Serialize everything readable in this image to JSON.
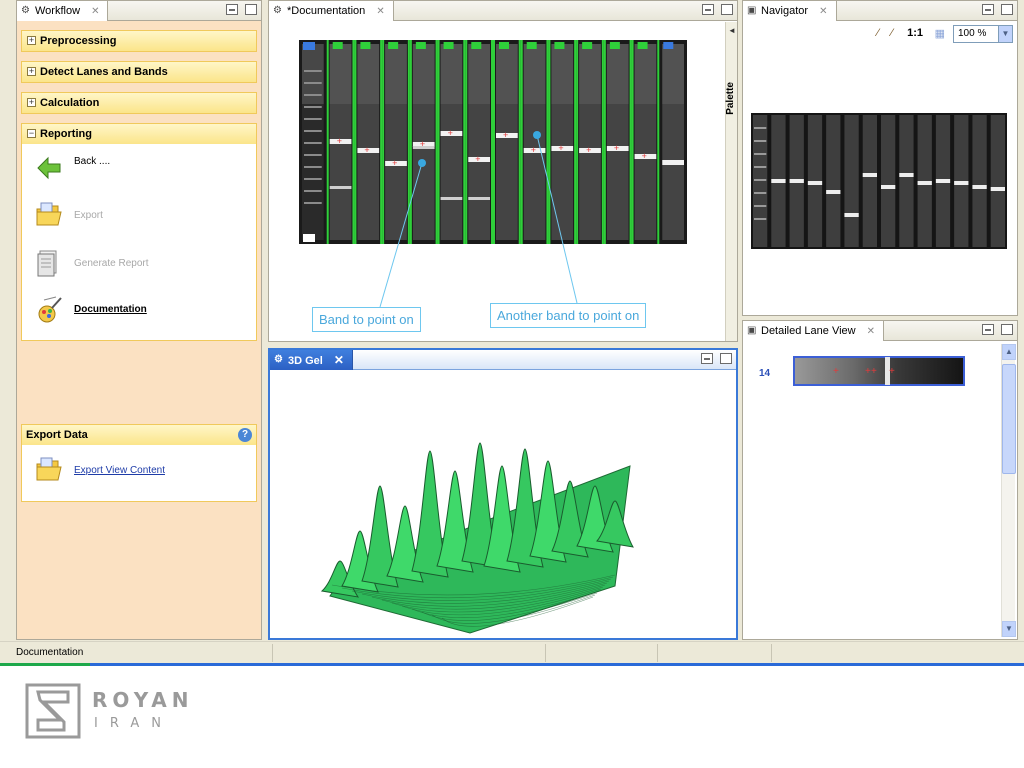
{
  "workflow": {
    "tab_title": "Workflow",
    "sections": [
      {
        "title": "Preprocessing"
      },
      {
        "title": "Detect Lanes and Bands"
      },
      {
        "title": "Calculation"
      },
      {
        "title": "Reporting"
      }
    ],
    "reporting_items": [
      {
        "label": "Back ....",
        "icon": "back-arrow-icon",
        "enabled": true
      },
      {
        "label": "Export",
        "icon": "export-folder-icon",
        "enabled": false
      },
      {
        "label": "Generate Report",
        "icon": "report-icon",
        "enabled": false
      },
      {
        "label": "Documentation",
        "icon": "documentation-icon",
        "enabled": true,
        "active": true
      }
    ],
    "export_data": {
      "title": "Export Data",
      "item_label": "Export View Content"
    }
  },
  "documentation": {
    "tab_title": "*Documentation",
    "palette_label": "Palette",
    "callouts": [
      "Band to point on",
      "Another band to point on"
    ]
  },
  "navigator": {
    "tab_title": "Navigator",
    "zoom_ratio_label": "1:1",
    "zoom_value": "100 %"
  },
  "lane_view": {
    "tab_title": "Detailed Lane View",
    "lane_number": "14"
  },
  "gel3d": {
    "tab_title": "3D Gel"
  },
  "status_bar": {
    "text": "Documentation"
  },
  "logo": {
    "word1": "ROYAN",
    "word2": "IRAN"
  },
  "colors": {
    "workflow_bg": "#fbe1c2",
    "section_header": "#fbe58a",
    "gel_green": "#3fd96a",
    "callout_blue": "#4aa8dc",
    "active_tab_blue": "#2c60c4"
  }
}
